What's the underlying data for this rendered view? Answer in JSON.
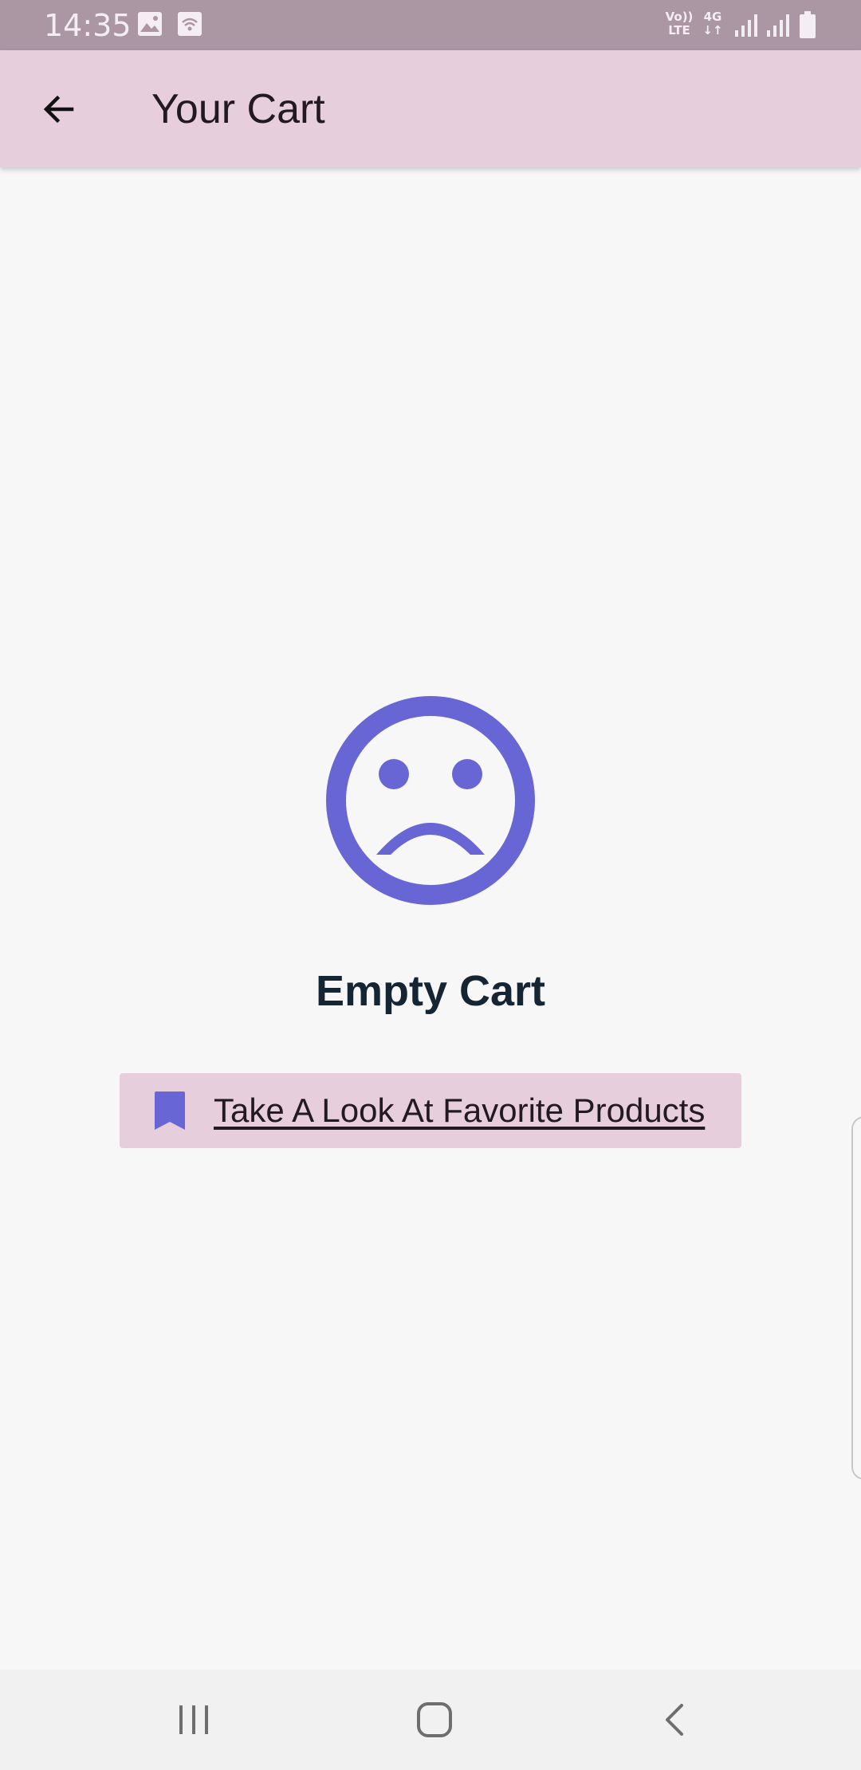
{
  "status_bar": {
    "time": "14:35",
    "volte_line1": "Vo))",
    "volte_line2": "LTE",
    "network": "4G",
    "icons": [
      "image-icon",
      "wifi-icon",
      "volte-icon",
      "4g-data-icon",
      "signal-icon",
      "signal-icon",
      "battery-icon"
    ]
  },
  "app_bar": {
    "title": "Your Cart",
    "back_icon": "arrow-back-icon"
  },
  "empty_state": {
    "icon": "sad-face-icon",
    "title": "Empty Cart",
    "button_label": "Take A Look At Favorite Products",
    "button_icon": "bookmark-icon"
  },
  "nav_bar": {
    "icons": [
      "recent-apps-icon",
      "home-icon",
      "back-icon"
    ]
  },
  "colors": {
    "status_bar": "#ab96a4",
    "app_bar": "#e7cedd",
    "accent": "#6766d4",
    "background": "#f7f7f8",
    "title_text": "#152533"
  }
}
